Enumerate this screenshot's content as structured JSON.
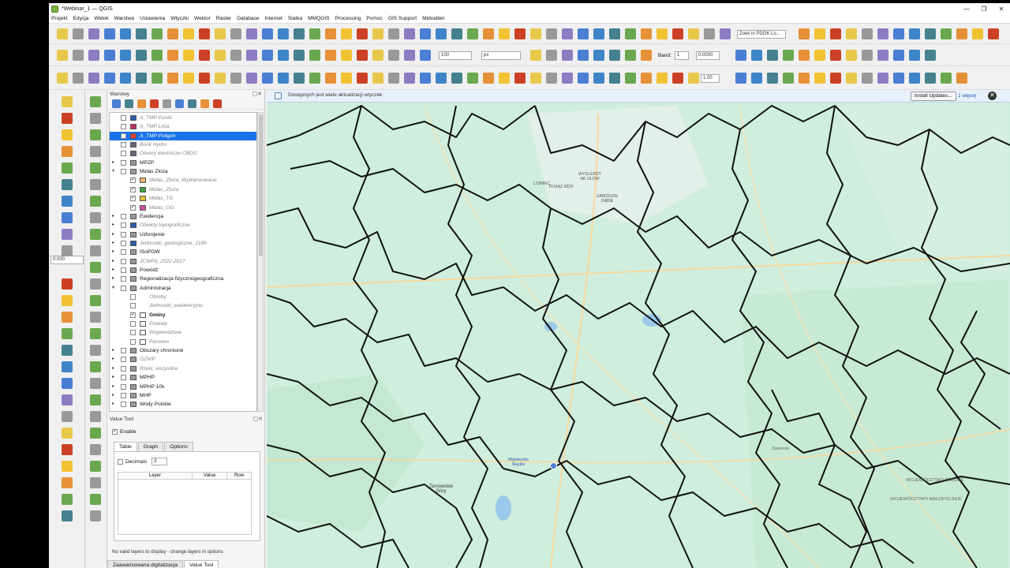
{
  "window": {
    "title": "*Webinar_1 — QGIS",
    "controls": [
      "—",
      "❐",
      "✕"
    ]
  },
  "menu": [
    "Projekt",
    "Edycja",
    "Widok",
    "Warstwa",
    "Ustawienia",
    "Wtyczki",
    "Wektor",
    "Raster",
    "Database",
    "Internet",
    "Siatka",
    "MMQGIS",
    "Processing",
    "Pomoc",
    "GIS Support",
    "Midvatten"
  ],
  "toolbar": {
    "search_placeholder": "Zoek in PDOK Lo...",
    "scale_value": "100",
    "unit_value": "px",
    "band_label": "Band:",
    "band_value": "1",
    "band_num": "0.0000",
    "line_width": "1.00",
    "left_spin": "0.000"
  },
  "layers_panel": {
    "title": "Warstwy",
    "rows": [
      {
        "label": "A_TMP Punkt",
        "style": "it",
        "checked": false,
        "sym": "#2d5fa8"
      },
      {
        "label": "A_TMP Linia",
        "style": "it",
        "checked": false,
        "sym": "#c03060"
      },
      {
        "label": "A_TMP Poligon",
        "style": "it",
        "checked": false,
        "sym": "#e04040",
        "selected": true
      },
      {
        "label": "Bonk Hydro",
        "style": "it",
        "checked": false,
        "sym": "#667"
      },
      {
        "label": "Otwory wiertnicze CBDG",
        "style": "it",
        "checked": false,
        "sym": "#667"
      },
      {
        "label": "MPZP",
        "style": "",
        "checked": false,
        "sym": "#999",
        "arrow": "▸"
      },
      {
        "label": "Midas Zloza",
        "style": "",
        "checked": false,
        "sym": "#999",
        "arrow": "▾"
      },
      {
        "label": "Midas_Zloza_Wyblansowane",
        "style": "it",
        "checked": true,
        "sym": "#f0b070",
        "indent": 1
      },
      {
        "label": "Midas_Zloza",
        "style": "it",
        "checked": true,
        "sym": "#40a040",
        "indent": 1
      },
      {
        "label": "Midas_TG",
        "style": "it",
        "checked": true,
        "sym": "#e0c040",
        "indent": 1
      },
      {
        "label": "Midas_OG",
        "style": "it",
        "checked": true,
        "sym": "#d050a0",
        "indent": 1
      },
      {
        "label": "Ewidencja",
        "style": "",
        "checked": false,
        "sym": "#999",
        "arrow": "▸"
      },
      {
        "label": "Obiekty topograficzne",
        "style": "it",
        "checked": false,
        "sym": "#2d5fa8",
        "arrow": "▸"
      },
      {
        "label": "Uzbrojenie",
        "style": "",
        "checked": false,
        "sym": "#999",
        "arrow": "▸"
      },
      {
        "label": "Jednostki_geologiczne_2180",
        "style": "it",
        "checked": false,
        "sym": "#2d5fa8",
        "arrow": "▸"
      },
      {
        "label": "ISoPGW",
        "style": "",
        "checked": false,
        "sym": "#999",
        "arrow": "▸"
      },
      {
        "label": "JCWPd_2022-2027",
        "style": "it",
        "checked": false,
        "sym": "#999",
        "arrow": "▸"
      },
      {
        "label": "Powódź",
        "style": "",
        "checked": false,
        "sym": "#999",
        "arrow": "▸"
      },
      {
        "label": "Regionalizacja fizycznogeograficzna",
        "style": "",
        "checked": false,
        "sym": "#999",
        "arrow": "▸"
      },
      {
        "label": "Administracja",
        "style": "",
        "checked": false,
        "sym": "#999",
        "arrow": "▾"
      },
      {
        "label": "Obreby",
        "style": "it",
        "checked": false,
        "sym": "",
        "indent": 1
      },
      {
        "label": "Jednostki_ewidencyjne",
        "style": "it",
        "checked": false,
        "sym": "",
        "indent": 1
      },
      {
        "label": "Gminy",
        "style": "bd",
        "checked": true,
        "sym": "#fff",
        "indent": 1
      },
      {
        "label": "Powiaty",
        "style": "it",
        "checked": false,
        "sym": "#fff",
        "indent": 1
      },
      {
        "label": "Wojewodztwa",
        "style": "it",
        "checked": false,
        "sym": "#fff",
        "indent": 1
      },
      {
        "label": "Panstwo",
        "style": "it",
        "checked": false,
        "sym": "#fff",
        "indent": 1
      },
      {
        "label": "Obszary chronione",
        "style": "",
        "checked": false,
        "sym": "#999",
        "arrow": "▸"
      },
      {
        "label": "GZWP",
        "style": "it",
        "checked": false,
        "sym": "#999",
        "arrow": "▸"
      },
      {
        "label": "Rzeki_wszystkie",
        "style": "it",
        "checked": false,
        "sym": "#999",
        "arrow": "▸"
      },
      {
        "label": "MPHP",
        "style": "",
        "checked": false,
        "sym": "#999",
        "arrow": "▸"
      },
      {
        "label": "MPHP 10k",
        "style": "",
        "checked": false,
        "sym": "#999",
        "arrow": "▸"
      },
      {
        "label": "MHP",
        "style": "",
        "checked": false,
        "sym": "#999",
        "arrow": "▸"
      },
      {
        "label": "Wody Polskie",
        "style": "",
        "checked": false,
        "sym": "#999",
        "arrow": "▸"
      }
    ]
  },
  "value_tool": {
    "title": "Value Tool",
    "enable_label": "Enable",
    "tabs": [
      "Table",
      "Graph",
      "Options"
    ],
    "decimals_label": "Decimals",
    "decimals_value": "2",
    "columns": [
      "Layer",
      "Value",
      "Row"
    ],
    "status": "No valid layers to display - change layers in options"
  },
  "bottom_tabs": [
    "Zaawansowana digitalizacja",
    "Value Tool"
  ],
  "message_bar": {
    "text": "Dostępnych jest wiele aktualizacji wtyczek",
    "button": "Install Updates...",
    "more": "1 więcej"
  },
  "map_labels": {
    "l1": "WYGLERZY\nAK OLÓW",
    "l2": "LISINIEC",
    "l3": "TKSIĄŻ KĘDI",
    "l4": "ZAWODZIE\nDĄBIE",
    "l5": "Tarnowskie\nGóry",
    "l6": "WOJEWÓDZTWO ŚLĄSKIE",
    "l7": "WOJEWÓDZTWO MAŁOPOLSKIE",
    "l8": "Miasteczko\nŚląskie",
    "l9": "Zawiercie"
  },
  "colors": {
    "accent": "#1a73e8",
    "map_bg": "#cfeedd",
    "boundary": "#111111"
  }
}
